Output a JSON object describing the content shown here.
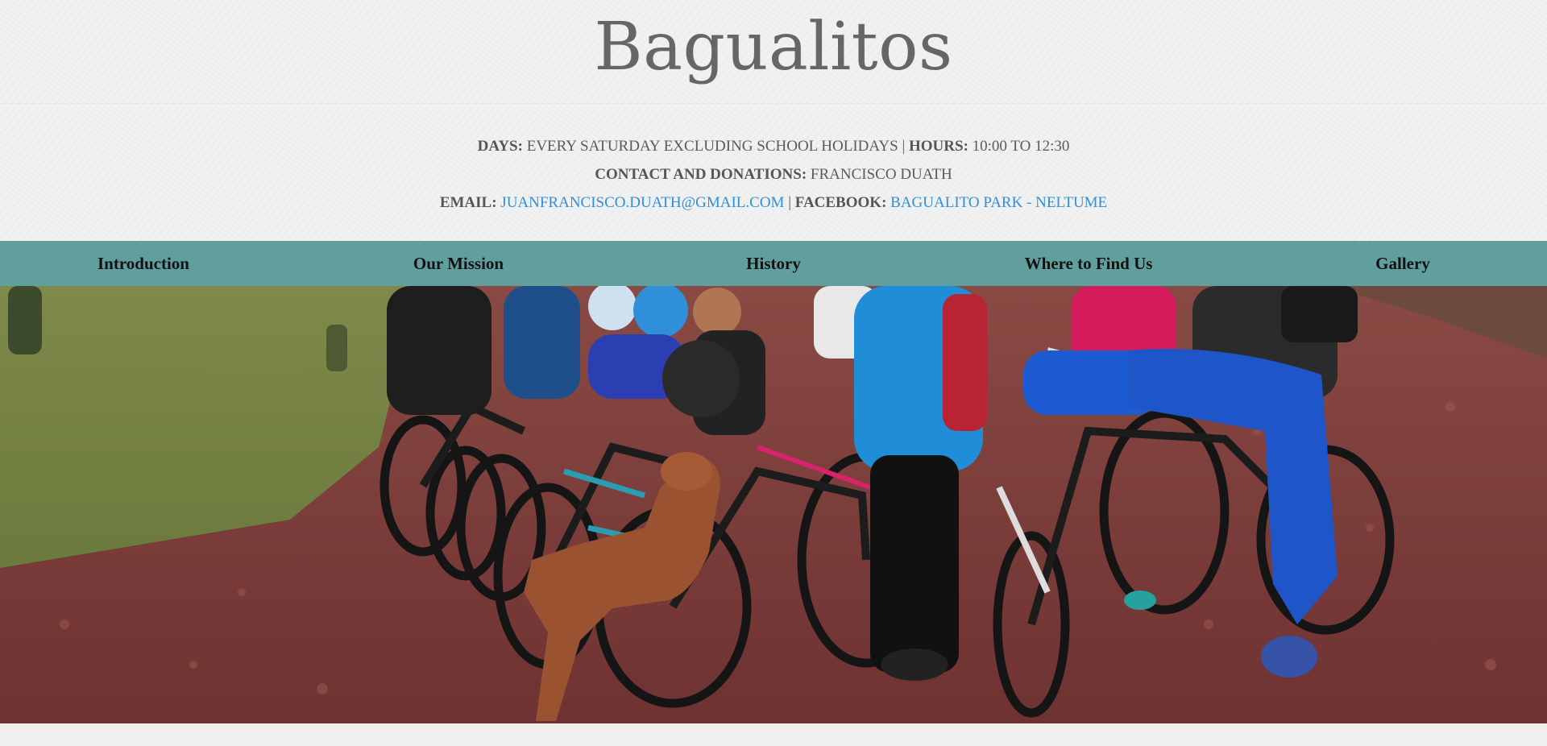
{
  "site": {
    "title": "Bagualitos"
  },
  "info": {
    "days_label": "DAYS:",
    "days_value": "EVERY SATURDAY EXCLUDING SCHOOL HOLIDAYS",
    "sep1": "|",
    "hours_label": "HOURS:",
    "hours_value": "10:00 TO 12:30",
    "contact_label": "CONTACT AND DONATIONS:",
    "contact_value": "FRANCISCO DUATH",
    "email_label": "EMAIL:",
    "email_value": "JUANFRANCISCO.DUATH@GMAIL.COM",
    "sep2": "|",
    "facebook_label": "FACEBOOK:",
    "facebook_value": "BAGUALITO PARK - NELTUME"
  },
  "nav": {
    "items": [
      {
        "label": "Introduction"
      },
      {
        "label": "Our Mission"
      },
      {
        "label": "History"
      },
      {
        "label": "Where to Find Us"
      },
      {
        "label": "Gallery"
      }
    ]
  },
  "colors": {
    "nav_bg": "#619e9e",
    "link": "#2f8fd8",
    "title": "#666666"
  }
}
